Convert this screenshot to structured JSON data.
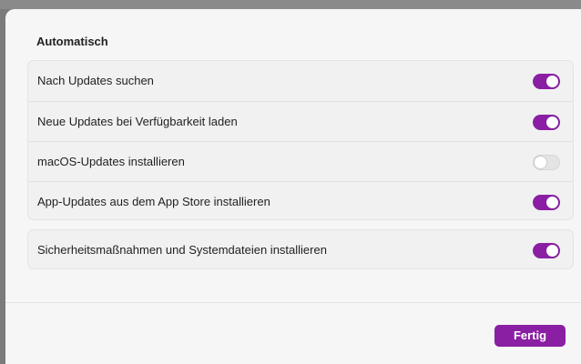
{
  "colors": {
    "accent": "#8a1fa3",
    "toggle_off": "#e4e4e4",
    "sheet_background": "#f6f6f6"
  },
  "section": {
    "title": "Automatisch"
  },
  "settings": [
    {
      "label": "Nach Updates suchen",
      "enabled": true
    },
    {
      "label": "Neue Updates bei Verfügbarkeit laden",
      "enabled": true
    },
    {
      "label": "macOS-Updates installieren",
      "enabled": false
    },
    {
      "label": "App-Updates aus dem App Store installieren",
      "enabled": true
    }
  ],
  "security": {
    "label": "Sicherheitsmaßnahmen und Systemdateien installieren",
    "enabled": true
  },
  "footer": {
    "done_label": "Fertig"
  }
}
